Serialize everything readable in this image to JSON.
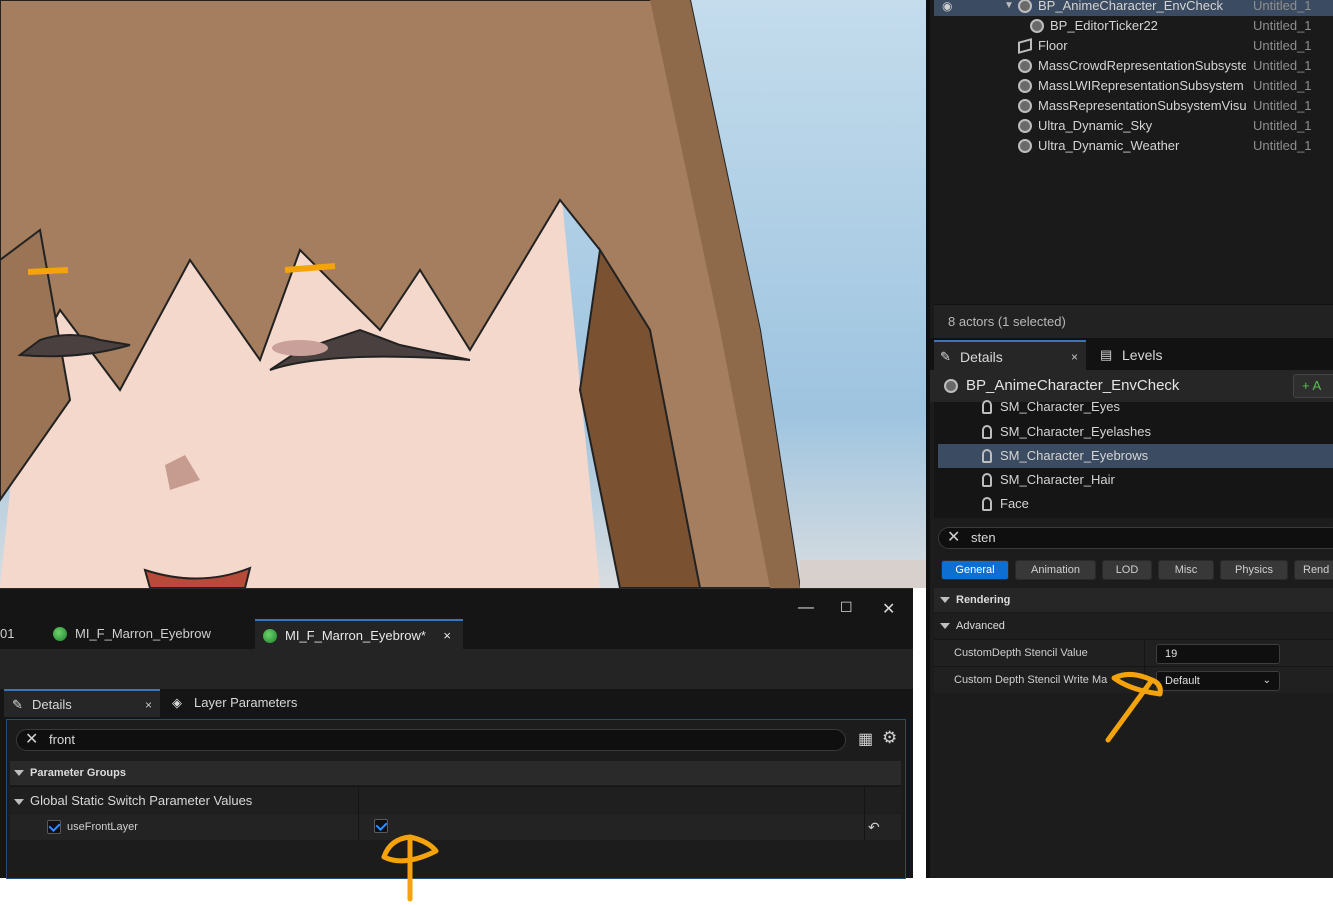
{
  "outliner": {
    "rows": [
      {
        "name": "BP_AnimeCharacter_EnvCheck",
        "level": "Untitled_1"
      },
      {
        "name": "BP_EditorTicker22",
        "level": "Untitled_1"
      },
      {
        "name": "Floor",
        "level": "Untitled_1"
      },
      {
        "name": "MassCrowdRepresentationSubsyste",
        "level": "Untitled_1"
      },
      {
        "name": "MassLWIRepresentationSubsystem",
        "level": "Untitled_1"
      },
      {
        "name": "MassRepresentationSubsystemVisu",
        "level": "Untitled_1"
      },
      {
        "name": "Ultra_Dynamic_Sky",
        "level": "Untitled_1"
      },
      {
        "name": "Ultra_Dynamic_Weather",
        "level": "Untitled_1"
      }
    ],
    "footer": "8 actors (1 selected)"
  },
  "right_details": {
    "tabs": {
      "details": "Details",
      "levels": "Levels",
      "close": "×"
    },
    "actor_name": "BP_AnimeCharacter_EnvCheck",
    "add_button": "+ A",
    "components": [
      "SM_Character_Eyes",
      "SM_Character_Eyelashes",
      "SM_Character_Eyebrows",
      "SM_Character_Hair",
      "Face"
    ],
    "search_value": "sten",
    "filters": [
      "General",
      "Animation",
      "LOD",
      "Misc",
      "Physics",
      "Rend"
    ],
    "section": "Rendering",
    "subsection": "Advanced",
    "props": {
      "stencil_label": "CustomDepth Stencil Value",
      "stencil_value": "19",
      "write_mask_label": "Custom Depth Stencil Write Ma",
      "write_mask_value": "Default"
    }
  },
  "material_editor": {
    "tabs": [
      "01",
      "MI_F_Marron_Eyebrow",
      "MI_F_Marron_Eyebrow*"
    ],
    "tab_close": "×",
    "win": {
      "min": "—",
      "max": "☐",
      "close": "✕"
    },
    "panel_tabs": {
      "details": "Details",
      "layers": "Layer Parameters",
      "close": "×"
    },
    "search_value": "front",
    "group_header": "Parameter Groups",
    "switch_group": "Global Static Switch Parameter Values",
    "param_name": "useFrontLayer",
    "reset_icon": "↶"
  },
  "colors": {
    "accent": "#0f6fd1",
    "selection": "#3b4b61",
    "annotation": "#f5a30a"
  }
}
